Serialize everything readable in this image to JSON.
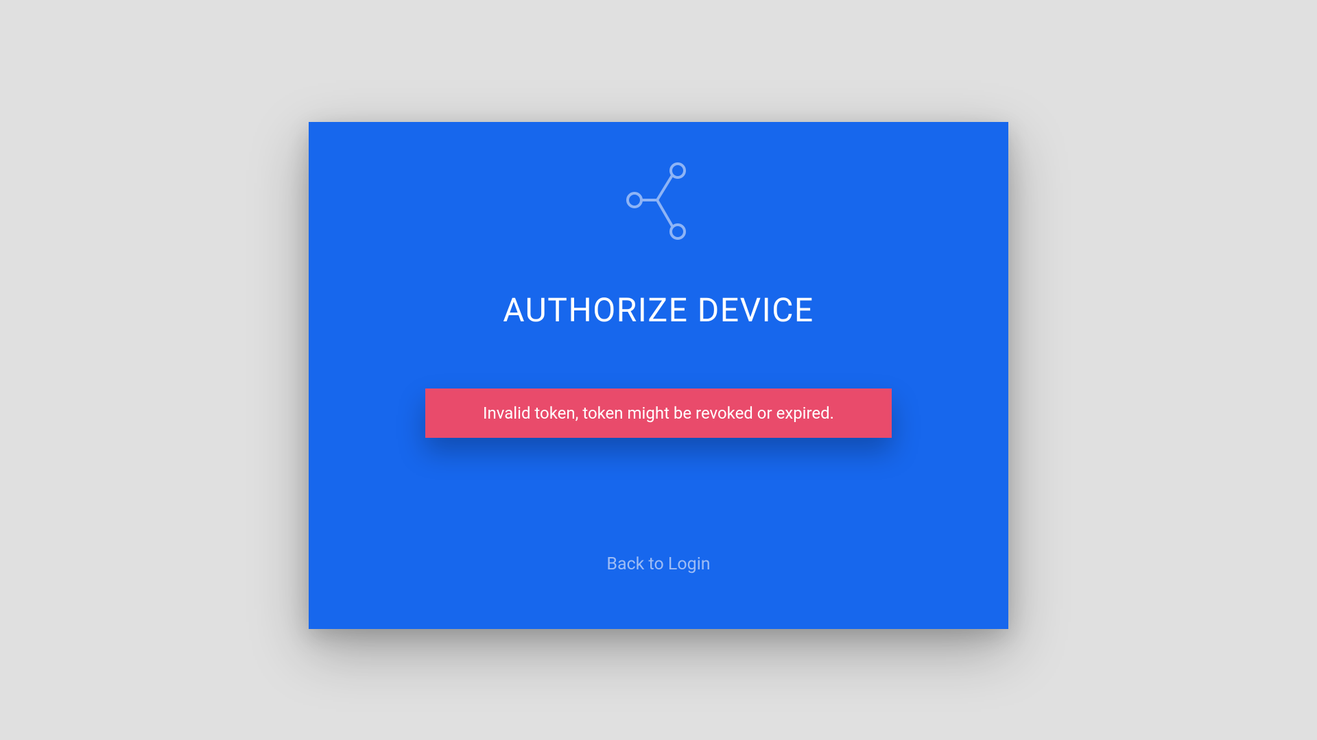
{
  "card": {
    "title": "AUTHORIZE DEVICE",
    "error_message": "Invalid token, token might be revoked or expired.",
    "back_link_label": "Back to Login"
  },
  "colors": {
    "card_bg": "#1767ed",
    "error_bg": "#e94b6b",
    "page_bg": "#e0e0e0"
  }
}
